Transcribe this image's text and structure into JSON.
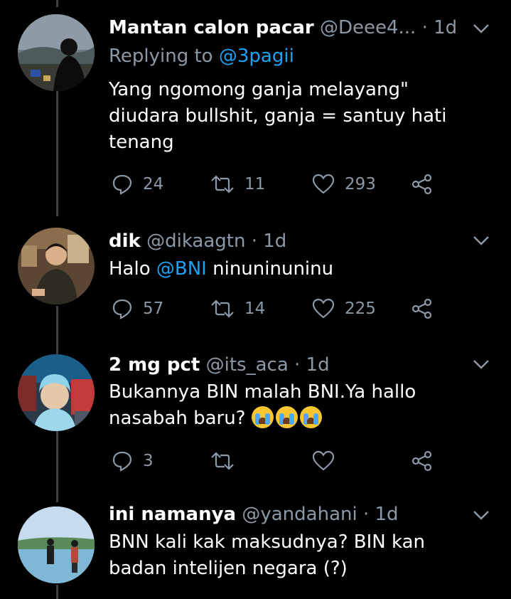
{
  "tweets": [
    {
      "name": "Mantan calon pacar",
      "handle": "@Deee4...",
      "dot": "·",
      "time": "1d",
      "replying_label": "Replying to",
      "replying_to": "@3pagii",
      "text_lines": [
        "Yang ngomong ganja melayang\"",
        "diudara bullshit, ganja = santuy hati",
        "tenang"
      ],
      "replies": "24",
      "retweets": "11",
      "likes": "293"
    },
    {
      "name": "dik",
      "handle": "@dikaagtn",
      "dot": "·",
      "time": "1d",
      "text_before": "Halo ",
      "mention": "@BNI",
      "text_after": " ninuninuninu",
      "replies": "57",
      "retweets": "14",
      "likes": "225"
    },
    {
      "name": "2 mg pct",
      "handle": "@its_aca",
      "dot": "·",
      "time": "1d",
      "text_line1": "Bukannya BIN malah BNI.Ya hallo",
      "text_line2": "nasabah baru?",
      "emoji_name": "loudly-crying-face-emoji",
      "replies": "3",
      "retweets": "",
      "likes": ""
    },
    {
      "name": "ini namanya",
      "handle": "@yandahani",
      "dot": "·",
      "time": "1d",
      "text_lines": [
        "BNN kali kak maksudnya? BIN kan",
        "badan intelijen negara (?)"
      ]
    }
  ],
  "icons": {
    "reply": "reply-bubble-icon",
    "retweet": "retweet-icon",
    "like": "heart-icon",
    "share": "share-icon",
    "more": "chevron-down-icon"
  },
  "colors": {
    "background": "#000000",
    "text": "#ffffff",
    "secondary": "#8b98a5",
    "link": "#1da1f2",
    "thread_line": "#3d4046"
  }
}
